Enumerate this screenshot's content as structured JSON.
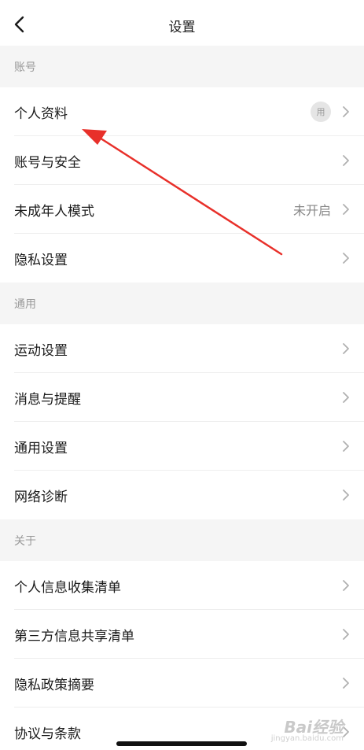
{
  "nav": {
    "title": "设置"
  },
  "sections": [
    {
      "header": "账号",
      "items": [
        {
          "label": "个人资料",
          "avatar_text": "用",
          "value": ""
        },
        {
          "label": "账号与安全",
          "value": ""
        },
        {
          "label": "未成年人模式",
          "value": "未开启"
        },
        {
          "label": "隐私设置",
          "value": ""
        }
      ]
    },
    {
      "header": "通用",
      "items": [
        {
          "label": "运动设置"
        },
        {
          "label": "消息与提醒"
        },
        {
          "label": "通用设置"
        },
        {
          "label": "网络诊断"
        }
      ]
    },
    {
      "header": "关于",
      "items": [
        {
          "label": "个人信息收集清单"
        },
        {
          "label": "第三方信息共享清单"
        },
        {
          "label": "隐私政策摘要"
        },
        {
          "label": "协议与条款"
        }
      ]
    }
  ],
  "watermark": {
    "main": "Bai经验",
    "sub": "jingyan.baidu.com"
  },
  "colors": {
    "arrow": "#e8302a",
    "section_bg": "#f5f5f5",
    "chevron": "#b0b0b0"
  }
}
